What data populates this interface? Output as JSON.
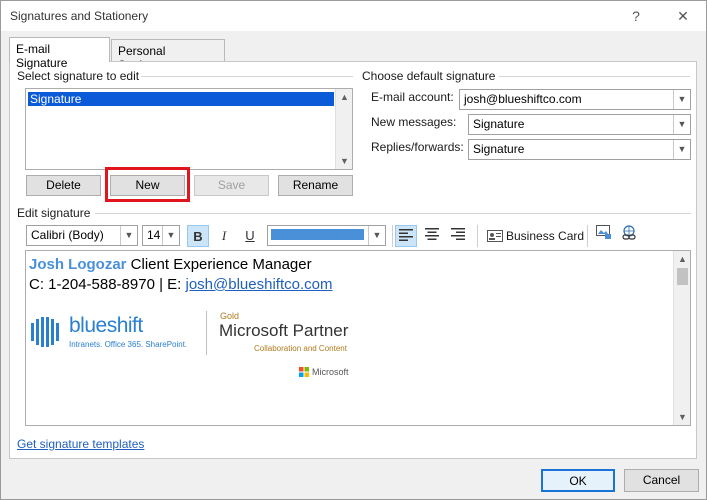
{
  "window": {
    "title": "Signatures and Stationery",
    "help": "?",
    "close": "✕"
  },
  "tabs": [
    {
      "label": "E-mail Signature",
      "active": true
    },
    {
      "label": "Personal Stationery",
      "active": false
    }
  ],
  "select_section": {
    "label": "Select signature to edit",
    "items": [
      "Signature"
    ]
  },
  "buttons": {
    "delete": "Delete",
    "new": "New",
    "save": "Save",
    "rename": "Rename"
  },
  "default_sig": {
    "label": "Choose default signature",
    "email_account_label": "E-mail account:",
    "email_account_value": "josh@blueshiftco.com",
    "new_messages_label": "New messages:",
    "new_messages_value": "Signature",
    "replies_label": "Replies/forwards:",
    "replies_value": "Signature"
  },
  "edit": {
    "label": "Edit signature",
    "font": "Calibri (Body)",
    "size": "14",
    "bold": "B",
    "italic": "I",
    "underline": "U",
    "color": "#4a90d9",
    "business_card": "Business Card"
  },
  "signature": {
    "name": "Josh Logozar",
    "role": " Client Experience Manager",
    "contact_prefix": "C: 1-204-588-8970 | E: ",
    "email": "josh@blueshiftco.com",
    "logo_brand": "blueshift",
    "logo_tagline": "Intranets. Office 365. SharePoint.",
    "partner_tier": "Gold",
    "partner_name": "Microsoft Partner",
    "partner_sub": "Collaboration and Content",
    "ms_label": "Microsoft"
  },
  "footer": {
    "templates_link": "Get signature templates",
    "ok": "OK",
    "cancel": "Cancel"
  },
  "colors": {
    "name_blue": "#4a90d9",
    "link_blue": "#1f5fbf",
    "highlight_red": "#e0151d",
    "selection": "#0b5bd8"
  }
}
